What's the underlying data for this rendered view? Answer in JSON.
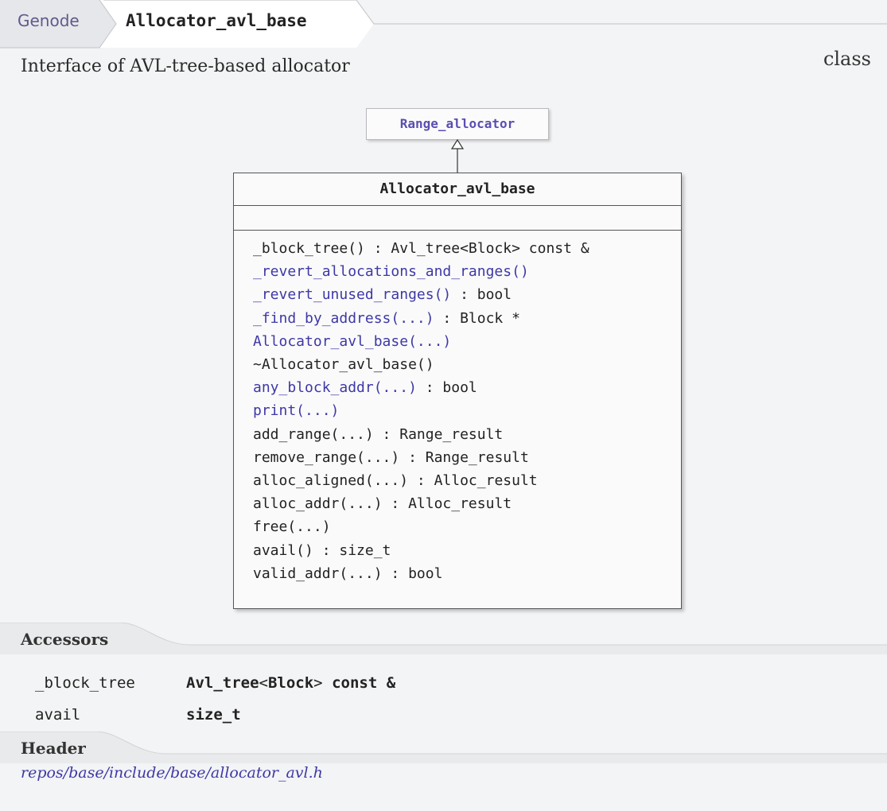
{
  "breadcrumb": {
    "root": "Genode",
    "current": "Allocator_avl_base"
  },
  "kind": "class",
  "description": "Interface of AVL-tree-based allocator",
  "diagram": {
    "base_class": "Range_allocator",
    "class_name": "Allocator_avl_base",
    "operations": [
      {
        "name": "_block_tree()",
        "ret": " : Avl_tree<Block> const &",
        "link": false
      },
      {
        "name": "_revert_allocations_and_ranges()",
        "ret": "",
        "link": true
      },
      {
        "name": "_revert_unused_ranges()",
        "ret": " : bool",
        "link": true
      },
      {
        "name": "_find_by_address(...)",
        "ret": " : Block *",
        "link": true
      },
      {
        "name": "Allocator_avl_base(...)",
        "ret": "",
        "link": true
      },
      {
        "name": "~Allocator_avl_base()",
        "ret": "",
        "link": false
      },
      {
        "name": "any_block_addr(...)",
        "ret": " : bool",
        "link": true
      },
      {
        "name": "print(...)",
        "ret": "",
        "link": true
      },
      {
        "name": "add_range(...)",
        "ret": " : Range_result",
        "link": false
      },
      {
        "name": "remove_range(...)",
        "ret": " : Range_result",
        "link": false
      },
      {
        "name": "alloc_aligned(...)",
        "ret": " : Alloc_result",
        "link": false
      },
      {
        "name": "alloc_addr(...)",
        "ret": " : Alloc_result",
        "link": false
      },
      {
        "name": "free(...)",
        "ret": "",
        "link": false
      },
      {
        "name": "avail()",
        "ret": " : size_t",
        "link": false
      },
      {
        "name": "valid_addr(...)",
        "ret": " : bool",
        "link": false
      }
    ]
  },
  "accessors": {
    "title": "Accessors",
    "rows": [
      {
        "name": "_block_tree",
        "type_a": "Avl_tree",
        "type_lt": "<",
        "type_b": "Block",
        "type_gt": ">",
        "type_c": " const &"
      },
      {
        "name": "avail",
        "type_a": "size_t",
        "type_lt": "",
        "type_b": "",
        "type_gt": "",
        "type_c": ""
      }
    ]
  },
  "header": {
    "title": "Header",
    "path": "repos/base/include/base/allocator_avl.h"
  }
}
